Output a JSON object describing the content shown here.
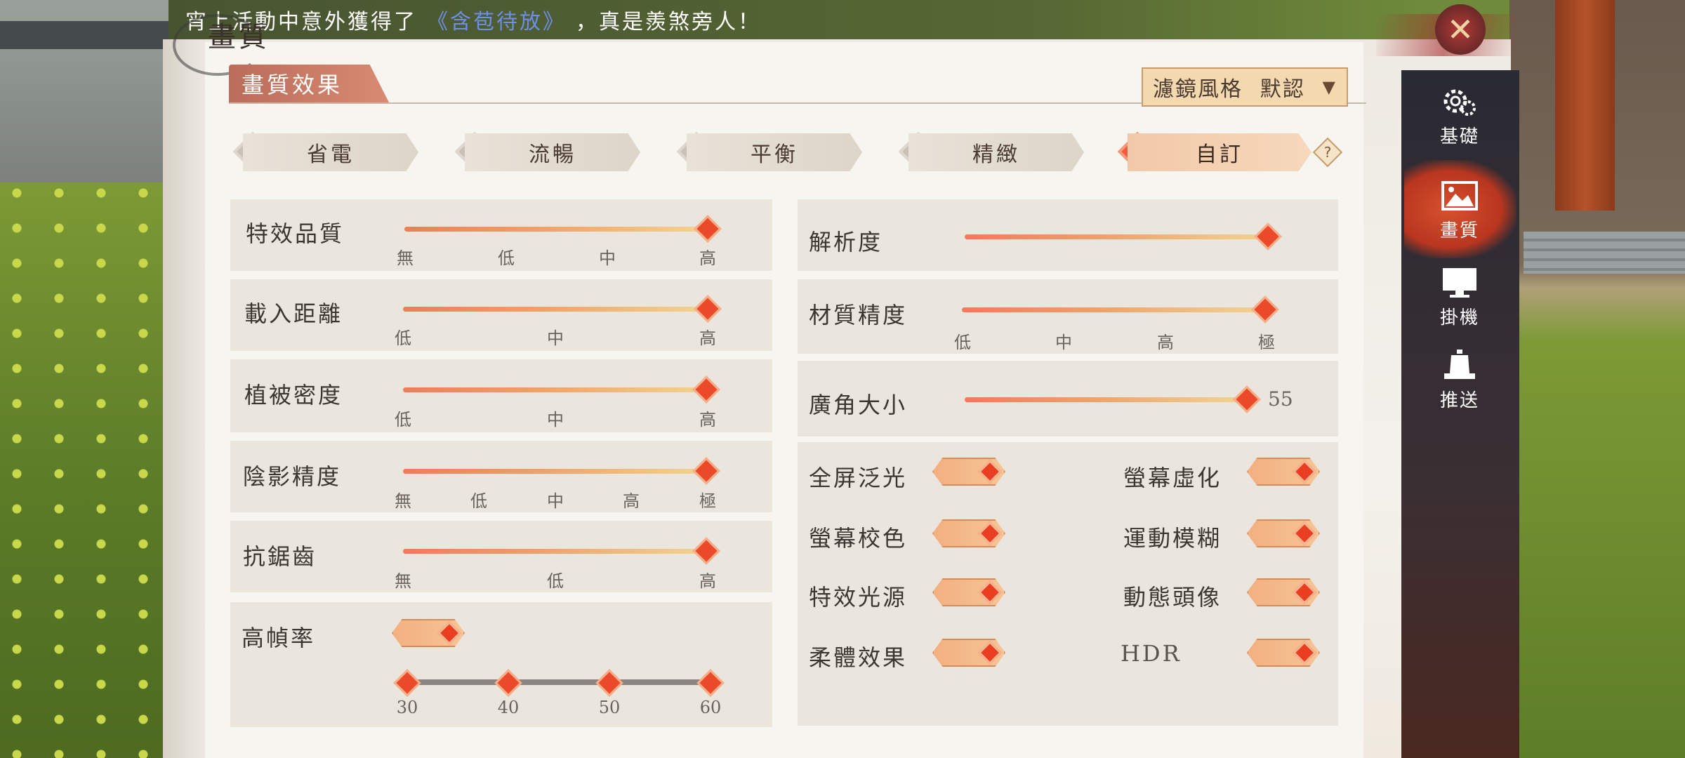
{
  "marquee": {
    "prefix": "宵上活動中意外獲得了",
    "item": "《含苞待放》",
    "suffix": "，真是羨煞旁人！"
  },
  "page_title": "畫質",
  "section_tab": "畫質效果",
  "filter": {
    "label": "濾鏡風格",
    "value": "默認",
    "arrow": "▼"
  },
  "presets": [
    {
      "label": "省電",
      "active": false
    },
    {
      "label": "流暢",
      "active": false
    },
    {
      "label": "平衡",
      "active": false
    },
    {
      "label": "精緻",
      "active": false
    },
    {
      "label": "自訂",
      "active": true
    }
  ],
  "help": "?",
  "left_settings": [
    {
      "label": "特效品質",
      "ticks": [
        "無",
        "低",
        "中",
        "高"
      ],
      "value": "高"
    },
    {
      "label": "載入距離",
      "ticks": [
        "低",
        "中",
        "高"
      ],
      "value": "高"
    },
    {
      "label": "植被密度",
      "ticks": [
        "低",
        "中",
        "高"
      ],
      "value": "高"
    },
    {
      "label": "陰影精度",
      "ticks": [
        "無",
        "低",
        "中",
        "高",
        "極"
      ],
      "value": "極"
    },
    {
      "label": "抗鋸齒",
      "ticks": [
        "無",
        "低",
        "高"
      ],
      "value": "高"
    }
  ],
  "high_fps": {
    "label": "高幀率",
    "on": true,
    "ticks": [
      "30",
      "40",
      "50",
      "60"
    ]
  },
  "right_settings": {
    "resolution": {
      "label": "解析度",
      "fill": 1.0
    },
    "texture": {
      "label": "材質精度",
      "ticks": [
        "低",
        "中",
        "高",
        "極"
      ],
      "value": "極"
    },
    "fov": {
      "label": "廣角大小",
      "value": "55",
      "fill": 0.95
    }
  },
  "toggles": [
    {
      "label": "全屏泛光",
      "on": true
    },
    {
      "label": "螢幕虛化",
      "on": true
    },
    {
      "label": "螢幕校色",
      "on": true
    },
    {
      "label": "運動模糊",
      "on": true
    },
    {
      "label": "特效光源",
      "on": true
    },
    {
      "label": "動態頭像",
      "on": true
    },
    {
      "label": "柔體效果",
      "on": true
    },
    {
      "label": "HDR",
      "on": true
    }
  ],
  "sidebar": {
    "items": [
      {
        "label": "基礎",
        "icon": "gear-icon",
        "active": false
      },
      {
        "label": "畫質",
        "icon": "image-icon",
        "active": true
      },
      {
        "label": "掛機",
        "icon": "monitor-icon",
        "active": false
      },
      {
        "label": "推送",
        "icon": "bell-icon",
        "active": false
      }
    ],
    "close": "✕"
  },
  "colors": {
    "accent": "#ea4a2a",
    "panel": "#f4f1ec",
    "sidebar": "#2a2a33",
    "marquee_highlight": "#6d8fe8"
  }
}
